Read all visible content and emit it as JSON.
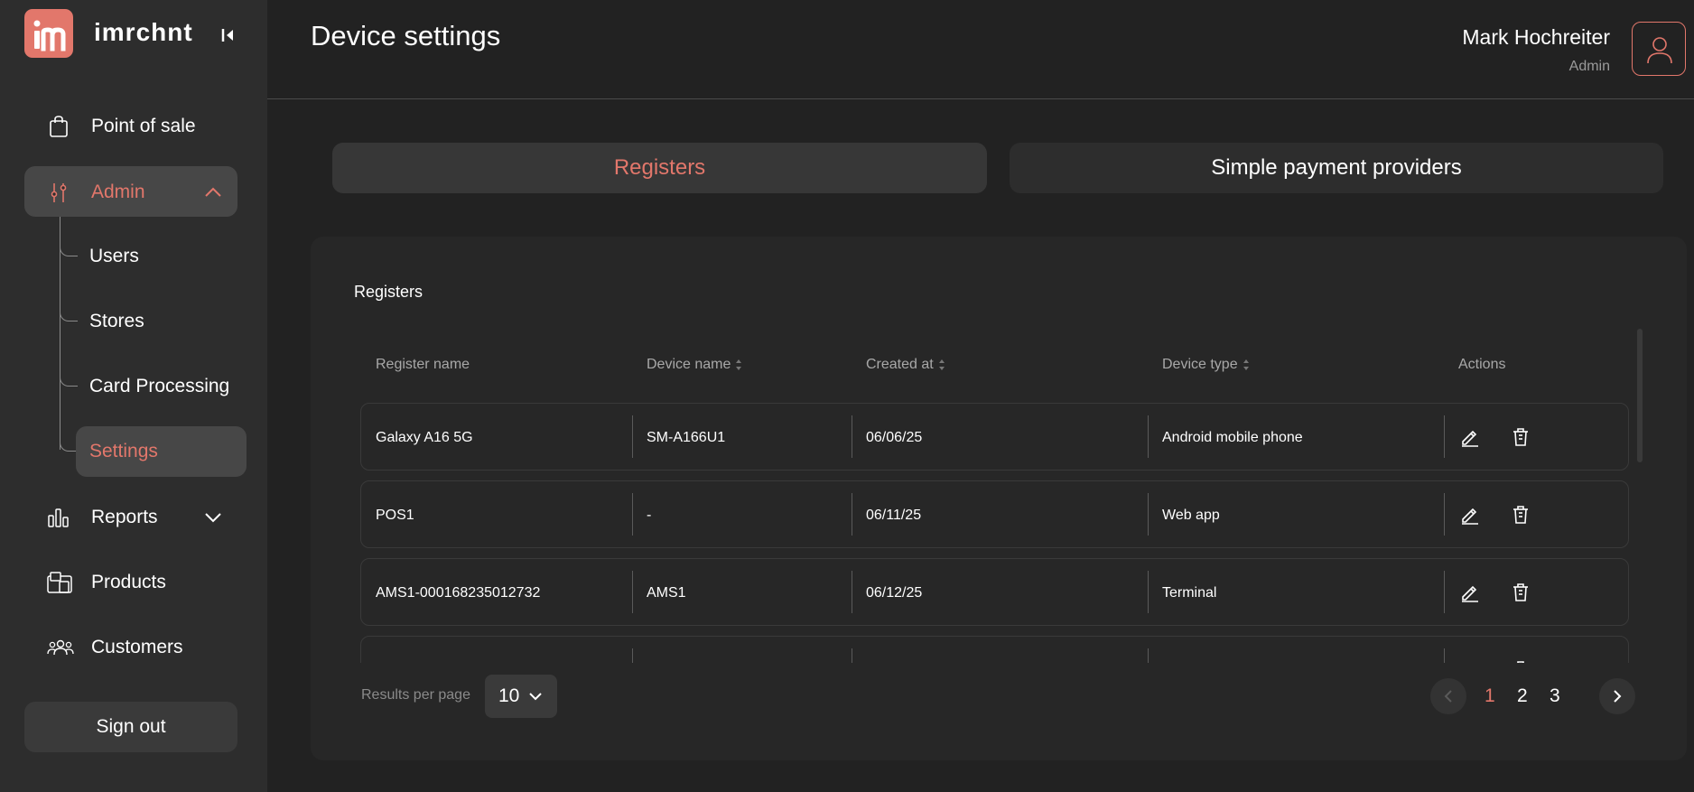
{
  "app": {
    "brand": "imrchnt",
    "accent_color": "#e2776b"
  },
  "sidebar": {
    "items": [
      {
        "label": "Point of sale",
        "icon": "shopping-bag-icon"
      },
      {
        "label": "Admin",
        "icon": "sliders-icon",
        "expanded": true
      },
      {
        "label": "Reports",
        "icon": "bar-chart-icon"
      },
      {
        "label": "Products",
        "icon": "products-icon"
      },
      {
        "label": "Customers",
        "icon": "customers-icon"
      }
    ],
    "admin_subitems": [
      "Users",
      "Stores",
      "Card Processing",
      "Settings"
    ],
    "active_subitem": "Settings",
    "signout_label": "Sign out"
  },
  "header": {
    "title": "Device settings",
    "user_name": "Mark Hochreiter",
    "user_role": "Admin"
  },
  "tabs": [
    {
      "label": "Registers",
      "active": true
    },
    {
      "label": "Simple payment providers",
      "active": false
    }
  ],
  "registers": {
    "title": "Registers",
    "columns": [
      "Register name",
      "Device name",
      "Created at",
      "Device type",
      "Actions"
    ],
    "rows": [
      {
        "register_name": "Galaxy A16 5G",
        "device_name": "SM-A166U1",
        "created_at": "06/06/25",
        "device_type": "Android mobile phone"
      },
      {
        "register_name": "POS1",
        "device_name": "-",
        "created_at": "06/11/25",
        "device_type": "Web app"
      },
      {
        "register_name": "AMS1-000168235012732",
        "device_name": "AMS1",
        "created_at": "06/12/25",
        "device_type": "Terminal"
      },
      {
        "register_name": "",
        "device_name": "",
        "created_at": "",
        "device_type": ""
      }
    ]
  },
  "pagination": {
    "results_per_page_label": "Results per page",
    "results_per_page": "10",
    "pages": [
      "1",
      "2",
      "3"
    ],
    "current_page": "1"
  }
}
